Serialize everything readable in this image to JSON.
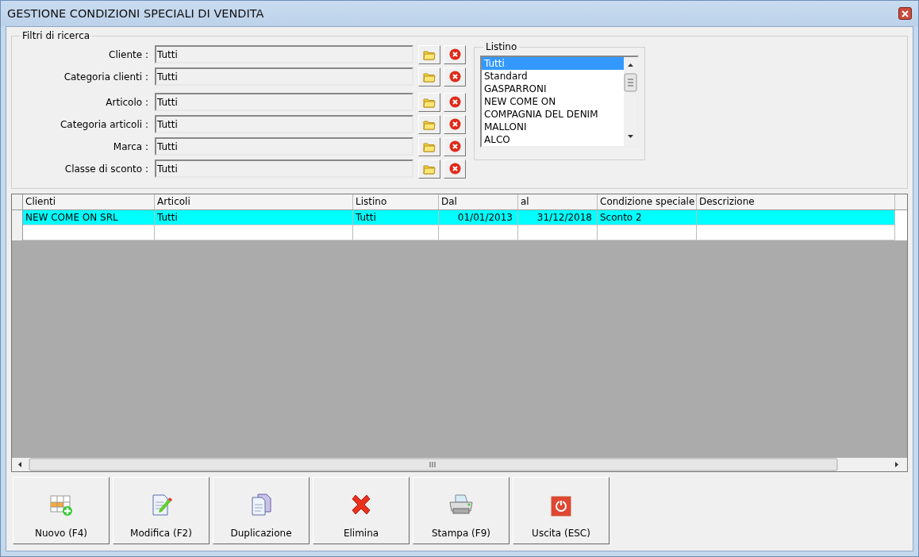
{
  "window": {
    "title": "GESTIONE CONDIZIONI SPECIALI DI VENDITA"
  },
  "filters": {
    "title": "Filtri di ricerca",
    "groups": [
      {
        "fields": [
          {
            "label": "Cliente :",
            "value": "Tutti"
          },
          {
            "label": "Categoria clienti :",
            "value": "Tutti"
          }
        ]
      },
      {
        "fields": [
          {
            "label": "Articolo :",
            "value": "Tutti"
          },
          {
            "label": "Categoria articoli :",
            "value": "Tutti"
          },
          {
            "label": "Marca :",
            "value": "Tutti"
          },
          {
            "label": "Classe di sconto :",
            "value": "Tutti"
          }
        ]
      }
    ]
  },
  "listino": {
    "title": "Listino",
    "items": [
      {
        "label": "Tutti",
        "selected": true
      },
      {
        "label": "Standard",
        "selected": false
      },
      {
        "label": "GASPARRONI",
        "selected": false
      },
      {
        "label": "NEW COME ON",
        "selected": false
      },
      {
        "label": "COMPAGNIA DEL DENIM",
        "selected": false
      },
      {
        "label": "MALLONI",
        "selected": false
      },
      {
        "label": "ALCO",
        "selected": false
      }
    ]
  },
  "table": {
    "columns": [
      "Clienti",
      "Articoli",
      "Listino",
      "Dal",
      "al",
      "Condizione speciale",
      "Descrizione"
    ],
    "rows": [
      {
        "selected": true,
        "cells": [
          "NEW COME ON SRL",
          "Tutti",
          "Tutti",
          "01/01/2013",
          "31/12/2018",
          "Sconto 2",
          ""
        ]
      }
    ]
  },
  "buttons": [
    {
      "kind": "new",
      "label": "Nuovo (F4)"
    },
    {
      "kind": "edit",
      "label": "Modifica (F2)"
    },
    {
      "kind": "copy",
      "label": "Duplicazione"
    },
    {
      "kind": "delete",
      "label": "Elimina"
    },
    {
      "kind": "print",
      "label": "Stampa (F9)"
    },
    {
      "kind": "exit",
      "label": "Uscita (ESC)"
    }
  ]
}
